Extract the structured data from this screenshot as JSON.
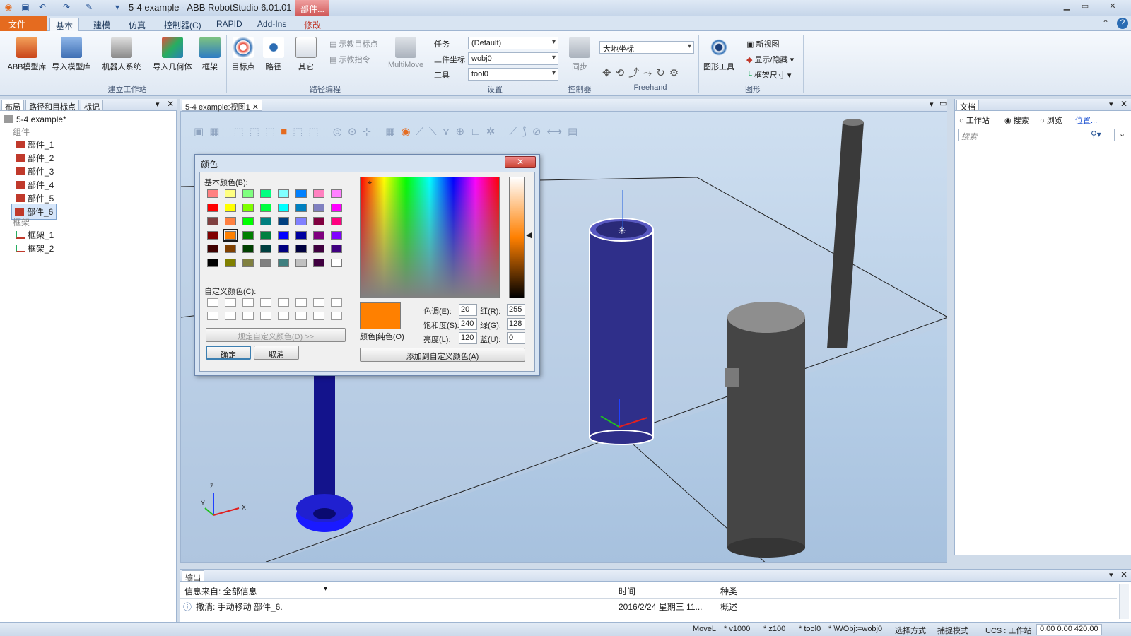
{
  "titlebar": {
    "title": "5-4 example - ABB RobotStudio 6.01.01",
    "context_tab": "部件...",
    "minimize": "▁",
    "restore": "▭",
    "close": "✕"
  },
  "tabs": {
    "file": "文件 (F)",
    "items": [
      "基本",
      "建模",
      "仿真",
      "控制器(C)",
      "RAPID",
      "Add-Ins",
      "修改"
    ]
  },
  "ribbon": {
    "build": {
      "abb_library": "ABB模型库",
      "import_library": "导入模型库",
      "robot_system": "机器人系统",
      "import_geometry": "导入几何体",
      "frame": "框架",
      "group": "建立工作站"
    },
    "path": {
      "target": "目标点",
      "path": "路径",
      "other": "其它",
      "teach_target": "示教目标点",
      "teach_instruction": "示教指令",
      "multimove": "MultiMove",
      "group": "路径编程"
    },
    "settings": {
      "task_label": "任务",
      "task_value": "(Default)",
      "wobj_label": "工件坐标",
      "wobj_value": "wobj0",
      "tool_label": "工具",
      "tool_value": "tool0",
      "group": "设置"
    },
    "controller": {
      "sync": "同步",
      "group": "控制器"
    },
    "freehand": {
      "coord": "大地坐标",
      "group": "Freehand"
    },
    "graphics": {
      "graphics_tools": "图形工具",
      "new_view": "新视图",
      "show_hide": "显示/隐藏",
      "frame_size": "框架尺寸",
      "group": "图形"
    }
  },
  "left_panel": {
    "tabs": [
      "布局",
      "路径和目标点",
      "标记"
    ],
    "root": "5-4 example*",
    "components_label": "组件",
    "components": [
      "部件_1",
      "部件_2",
      "部件_3",
      "部件_4",
      "部件_5",
      "部件_6"
    ],
    "frames_label": "框架",
    "frames": [
      "框架_1",
      "框架_2"
    ]
  },
  "view": {
    "tab": "5-4 example:视图1",
    "axis_x": "X",
    "axis_y": "Y",
    "axis_z": "Z"
  },
  "right_panel": {
    "title": "文档",
    "opt_station": "工作站",
    "opt_search": "搜索",
    "opt_browse": "浏览",
    "link": "位置...",
    "search_placeholder": "搜索"
  },
  "output": {
    "title": "输出",
    "source_label": "信息来自: 全部信息",
    "col_time": "时间",
    "col_type": "种类",
    "row": {
      "msg": "撤消: 手动移动 部件_6.",
      "time": "2016/2/24 星期三 11...",
      "type": "概述"
    }
  },
  "statusbar": {
    "movel": "MoveL",
    "speed": "* v1000",
    "zone": "* z100",
    "tool": "* tool0",
    "wobj": "* \\WObj:=wobj0",
    "select": "选择方式",
    "snap": "捕捉模式",
    "ucs": "UCS : 工作站",
    "coords": "0.00   0.00   420.00"
  },
  "dialog": {
    "title": "颜色",
    "basic_label": "基本颜色(B):",
    "custom_label": "自定义颜色(C):",
    "define_btn": "规定自定义颜色(D) >>",
    "ok": "确定",
    "cancel": "取消",
    "hue_label": "色调(E):",
    "hue": "20",
    "sat_label": "饱和度(S):",
    "sat": "240",
    "lum_label": "亮度(L):",
    "lum": "120",
    "red_label": "红(R):",
    "red": "255",
    "green_label": "绿(G):",
    "green": "128",
    "blue_label": "蓝(U):",
    "blue": "0",
    "solid_label": "颜色|纯色(O)",
    "add_btn": "添加到自定义颜色(A)",
    "selected_color": "#ff8000",
    "basic_colors": [
      "#ff8080",
      "#ffff80",
      "#80ff80",
      "#00ff80",
      "#80ffff",
      "#0080ff",
      "#ff80c0",
      "#ff80ff",
      "#ff0000",
      "#ffff00",
      "#80ff00",
      "#00ff40",
      "#00ffff",
      "#0080c0",
      "#8080c0",
      "#ff00ff",
      "#804040",
      "#ff8040",
      "#00ff00",
      "#008080",
      "#004080",
      "#8080ff",
      "#800040",
      "#ff0080",
      "#800000",
      "#ff8000",
      "#008000",
      "#008040",
      "#0000ff",
      "#0000a0",
      "#800080",
      "#8000ff",
      "#400000",
      "#804000",
      "#004000",
      "#004040",
      "#000080",
      "#000040",
      "#400040",
      "#400080",
      "#000000",
      "#808000",
      "#808040",
      "#808080",
      "#408080",
      "#c0c0c0",
      "#400040",
      "#ffffff"
    ]
  }
}
